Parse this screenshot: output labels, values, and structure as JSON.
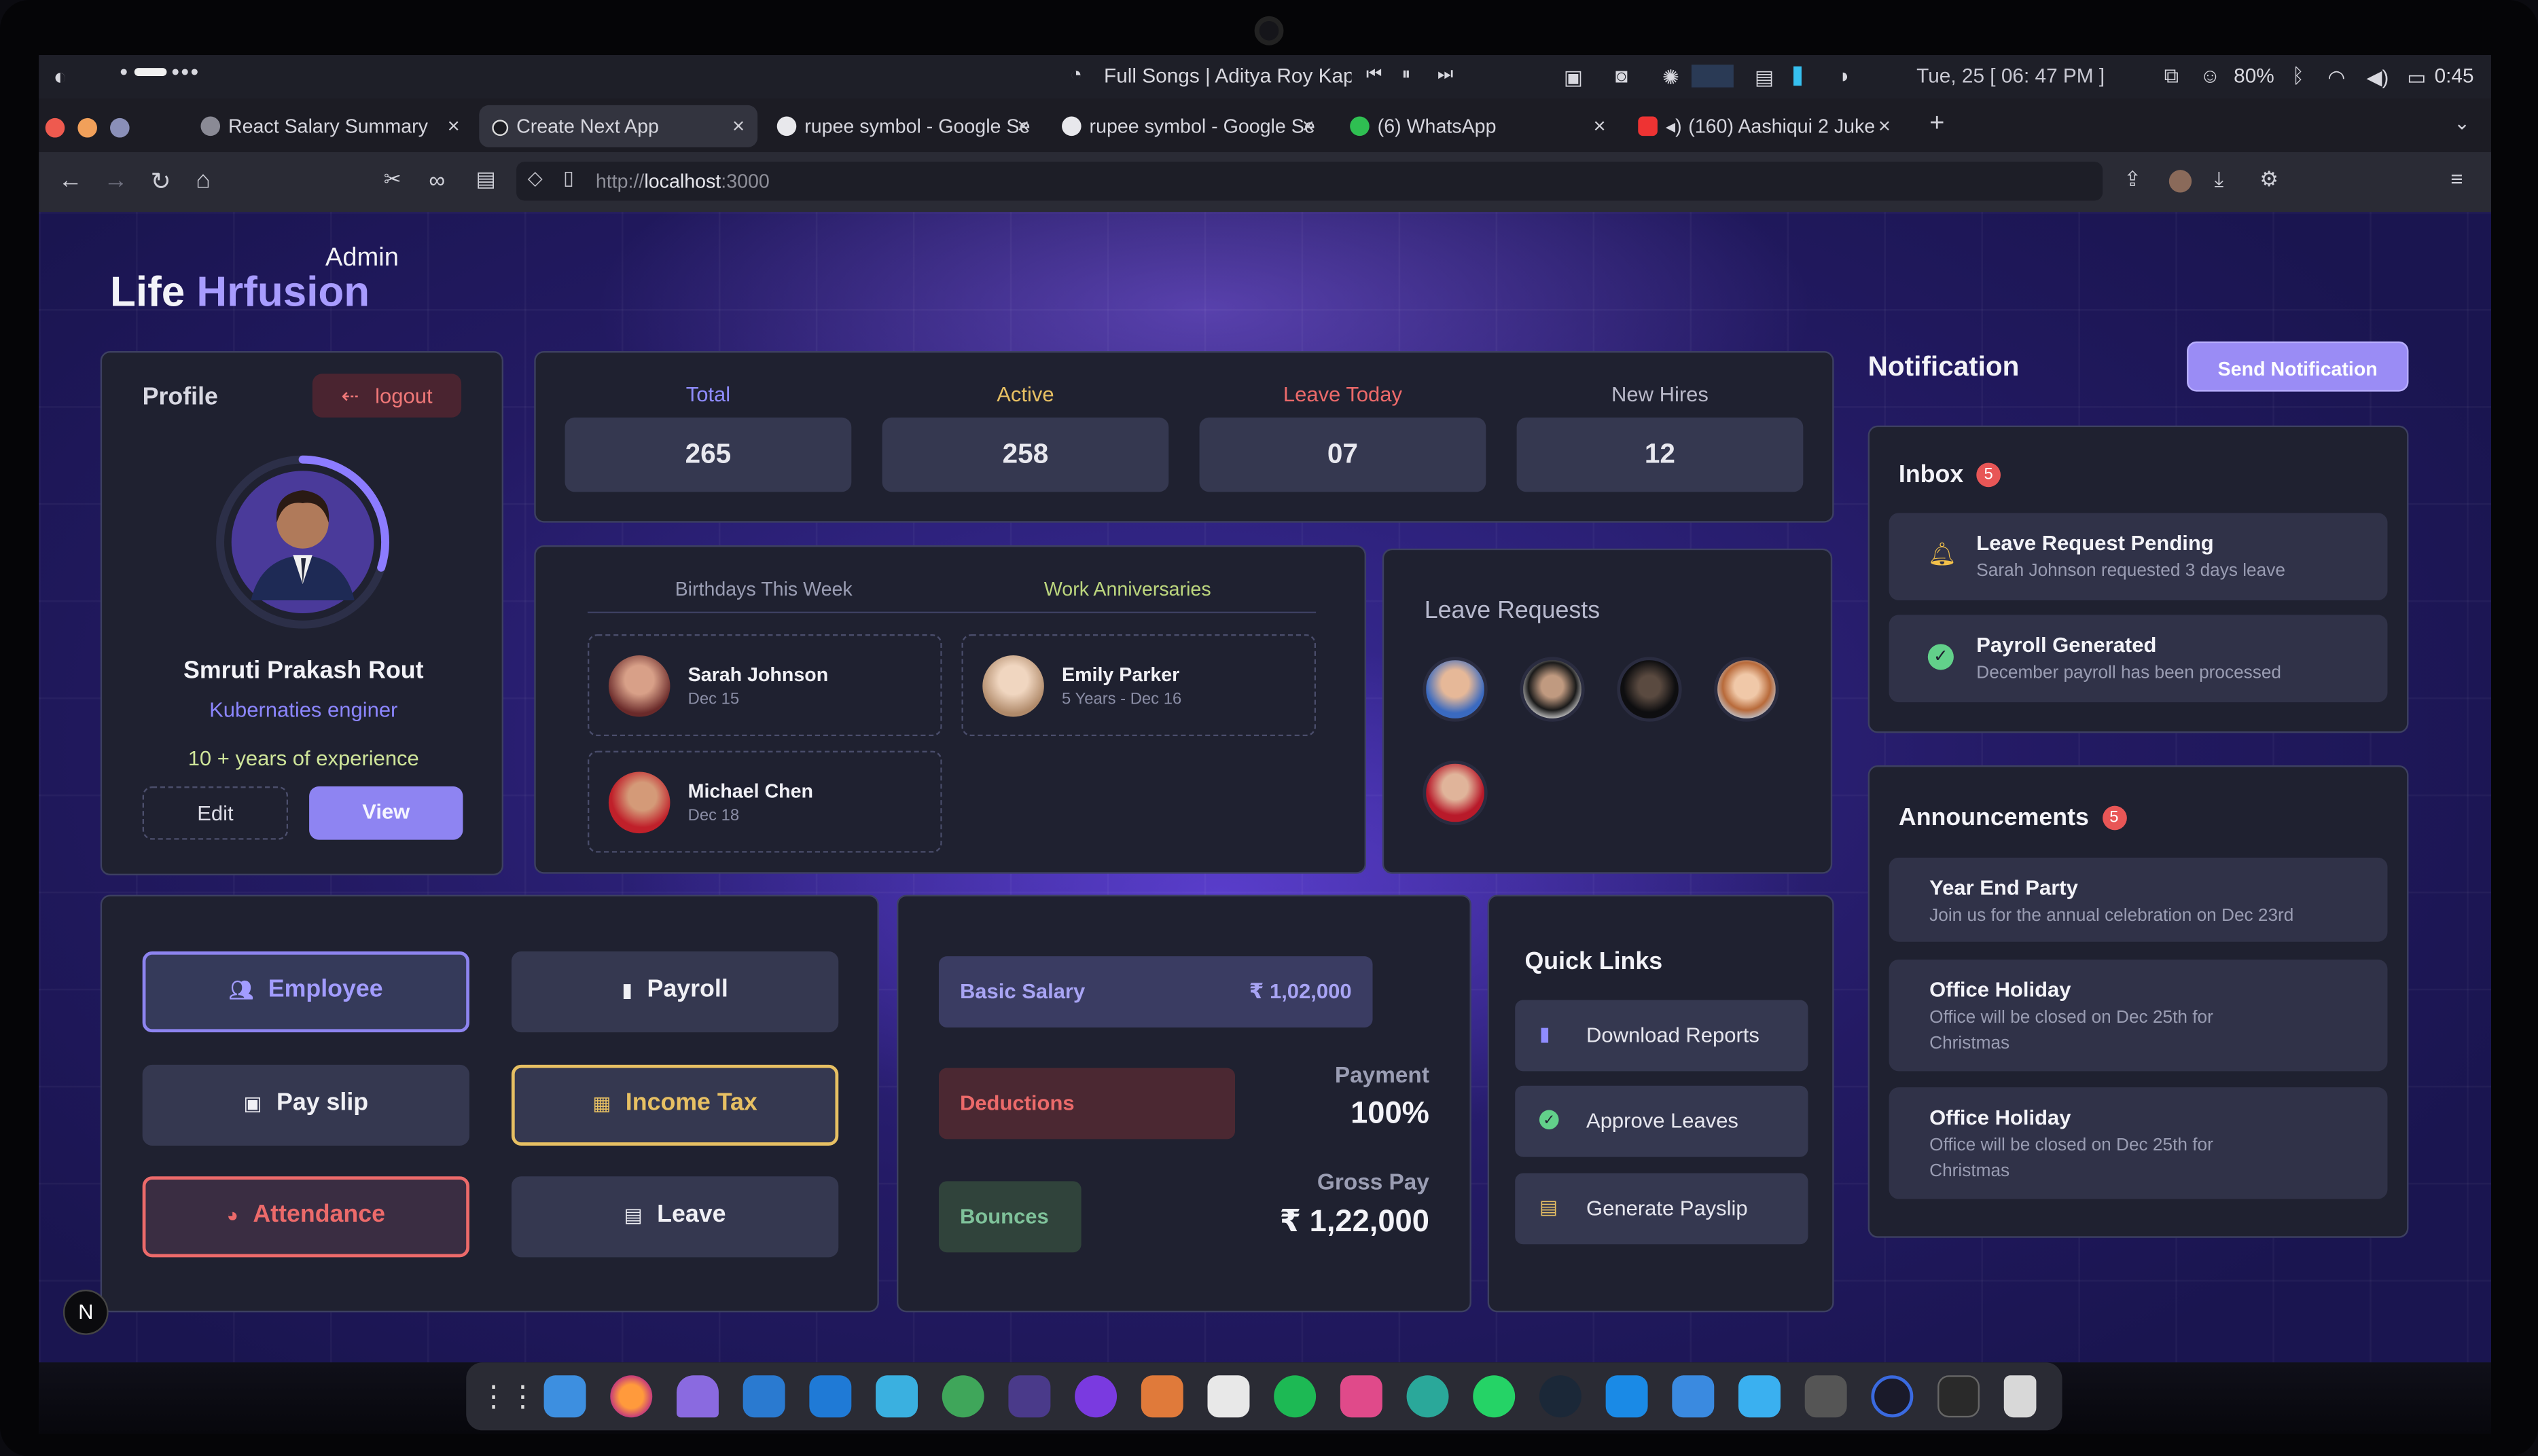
{
  "system_bar": {
    "media_title": "Full Songs | Aditya Roy Kapur",
    "datetime": "Tue, 25 [ 06: 47 PM ]",
    "battery_level": "80%",
    "clock": "0:45"
  },
  "browser": {
    "tabs": [
      {
        "title": "React Salary Summary",
        "icon": "react-icon"
      },
      {
        "title": "Create Next App",
        "icon": "nextjs-icon"
      },
      {
        "title": "rupee symbol - Google Se",
        "icon": "google-icon"
      },
      {
        "title": "rupee symbol - Google Se",
        "icon": "google-icon"
      },
      {
        "title": "(6) WhatsApp",
        "icon": "whatsapp-icon"
      },
      {
        "title": "(160) Aashiqui 2 Juke",
        "icon": "youtube-icon"
      }
    ],
    "url_prefix": "http://",
    "url_host": "localhost",
    "url_port": ":3000"
  },
  "header": {
    "role": "Admin",
    "brand_a": "Life",
    "brand_b": "Hrfusion"
  },
  "profile": {
    "title": "Profile",
    "logout_label": "logout",
    "name": "Smruti Prakash Rout",
    "role": "Kubernaties enginer",
    "experience": "10 + years of experience",
    "edit_label": "Edit",
    "view_label": "View",
    "progress": 0.3
  },
  "stats": [
    {
      "label": "Total",
      "value": "265",
      "color": "#8f8cff"
    },
    {
      "label": "Active",
      "value": "258",
      "color": "#e7c063"
    },
    {
      "label": "Leave Today",
      "value": "07",
      "color": "#ec6a6a"
    },
    {
      "label": "New Hires",
      "value": "12",
      "color": "#b9b9c9"
    }
  ],
  "events": {
    "birthdays_tab": "Birthdays This Week",
    "anniversaries_tab": "Work Anniversaries",
    "people": [
      {
        "name": "Sarah Johnson",
        "sub": "Dec 15"
      },
      {
        "name": "Emily Parker",
        "sub": "5 Years - Dec 16"
      },
      {
        "name": "Michael Chen",
        "sub": "Dec 18"
      }
    ]
  },
  "leave_requests": {
    "title": "Leave Requests"
  },
  "notification": {
    "title": "Notification",
    "send_label": "Send Notification"
  },
  "inbox": {
    "title": "Inbox",
    "count": "5",
    "items": [
      {
        "title": "Leave Request Pending",
        "sub": "Sarah Johnson requested 3 days leave",
        "icon": "bell-icon"
      },
      {
        "title": "Payroll Generated",
        "sub": "December payroll has been processed",
        "icon": "check-circle-icon"
      }
    ]
  },
  "announcements": {
    "title": "Announcements",
    "count": "5",
    "items": [
      {
        "title": "Year End Party",
        "sub": "Join us for the annual celebration on Dec 23rd"
      },
      {
        "title": "Office Holiday",
        "sub": "Office will be closed on Dec 25th for Christmas"
      },
      {
        "title": "Office Holiday",
        "sub": "Office will be closed on Dec 25th for Christmas"
      }
    ]
  },
  "modules": [
    {
      "label": "Employee",
      "icon": "users-icon"
    },
    {
      "label": "Payroll",
      "icon": "file-icon"
    },
    {
      "label": "Pay slip",
      "icon": "money-icon"
    },
    {
      "label": "Income Tax",
      "icon": "calculator-icon"
    },
    {
      "label": "Attendance",
      "icon": "clock-icon"
    },
    {
      "label": "Leave",
      "icon": "calendar-icon"
    }
  ],
  "salary": {
    "basic_label": "Basic Salary",
    "basic_value": "₹ 1,02,000",
    "deductions_label": "Deductions",
    "bounces_label": "Bounces",
    "payment_label": "Payment",
    "payment_value": "100%",
    "gross_label": "Gross Pay",
    "gross_value": "₹ 1,22,000"
  },
  "quick_links": {
    "title": "Quick Links",
    "items": [
      {
        "label": "Download Reports",
        "icon": "document-icon"
      },
      {
        "label": "Approve Leaves",
        "icon": "check-circle-icon"
      },
      {
        "label": "Generate Payslip",
        "icon": "receipt-icon"
      }
    ]
  },
  "nextjs_badge": "N"
}
